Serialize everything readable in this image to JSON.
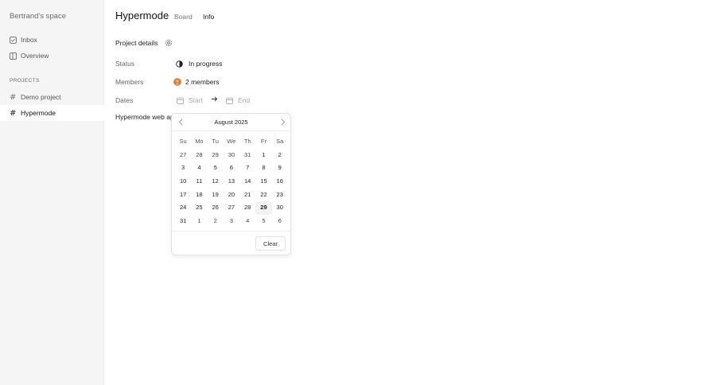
{
  "sidebar": {
    "workspace": "Bertrand's space",
    "nav": [
      {
        "label": "Inbox",
        "icon": "inbox-icon"
      },
      {
        "label": "Overview",
        "icon": "overview-icon"
      }
    ],
    "section_label": "PROJECTS",
    "projects": [
      {
        "label": "Demo project",
        "icon": "hash-icon"
      },
      {
        "label": "Hypermode",
        "icon": "hash-icon",
        "active": true
      }
    ]
  },
  "header": {
    "title": "Hypermode",
    "tabs": [
      {
        "label": "Board"
      },
      {
        "label": "Info",
        "active": true
      }
    ]
  },
  "details": {
    "heading": "Project details",
    "status": {
      "label": "Status",
      "value": "In progress"
    },
    "members": {
      "label": "Members",
      "value": "2 members",
      "avatar_color": "#e8742b"
    },
    "dates": {
      "label": "Dates",
      "start_placeholder": "Start",
      "end_placeholder": "End"
    },
    "description": "Hypermode web ap"
  },
  "calendar": {
    "title": "August 2025",
    "weekdays": [
      "Su",
      "Mo",
      "Tu",
      "We",
      "Th",
      "Fr",
      "Sa"
    ],
    "days": [
      {
        "d": "27",
        "out": true
      },
      {
        "d": "28",
        "out": true
      },
      {
        "d": "29",
        "out": true
      },
      {
        "d": "30",
        "out": true
      },
      {
        "d": "31",
        "out": true
      },
      {
        "d": "1"
      },
      {
        "d": "2"
      },
      {
        "d": "3"
      },
      {
        "d": "4"
      },
      {
        "d": "5"
      },
      {
        "d": "6"
      },
      {
        "d": "7"
      },
      {
        "d": "8"
      },
      {
        "d": "9"
      },
      {
        "d": "10"
      },
      {
        "d": "11"
      },
      {
        "d": "12"
      },
      {
        "d": "13"
      },
      {
        "d": "14"
      },
      {
        "d": "15"
      },
      {
        "d": "16"
      },
      {
        "d": "17"
      },
      {
        "d": "18"
      },
      {
        "d": "19"
      },
      {
        "d": "20"
      },
      {
        "d": "21"
      },
      {
        "d": "22"
      },
      {
        "d": "23"
      },
      {
        "d": "24"
      },
      {
        "d": "25"
      },
      {
        "d": "26"
      },
      {
        "d": "27"
      },
      {
        "d": "28"
      },
      {
        "d": "29",
        "today": true
      },
      {
        "d": "30"
      },
      {
        "d": "31"
      },
      {
        "d": "1",
        "out": true
      },
      {
        "d": "2",
        "out": true
      },
      {
        "d": "3",
        "out": true
      },
      {
        "d": "4",
        "out": true
      },
      {
        "d": "5",
        "out": true
      },
      {
        "d": "6",
        "out": true
      }
    ],
    "clear_label": "Clear"
  }
}
